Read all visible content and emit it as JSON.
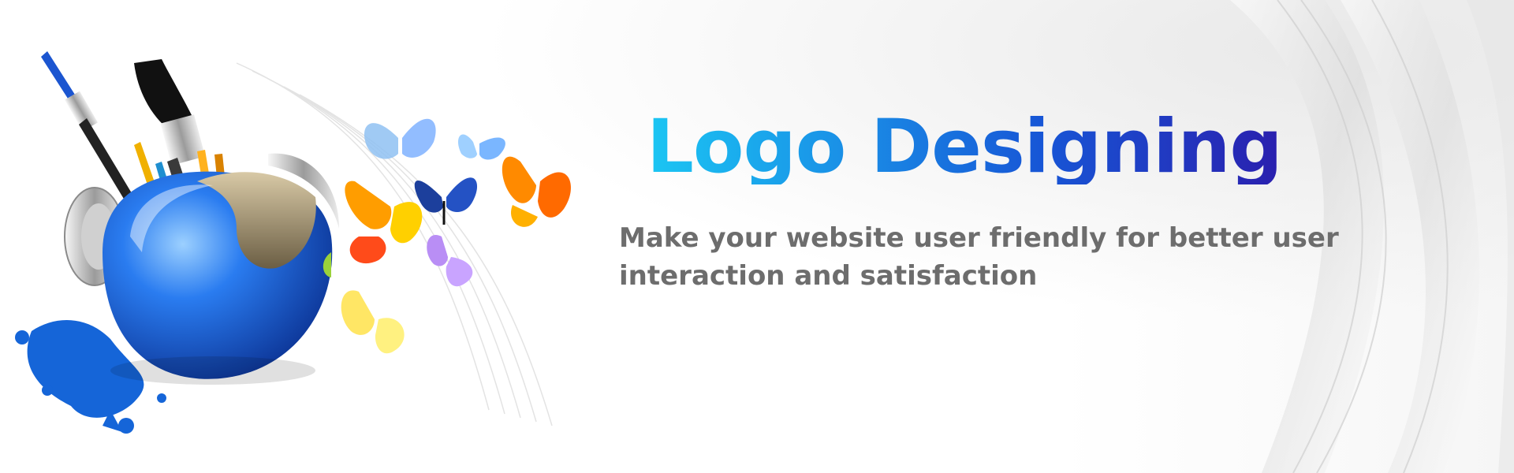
{
  "banner": {
    "headline": "Logo Designing",
    "tagline_line1": "Make your website user friendly for better user",
    "tagline_line2": "interaction and satisfaction"
  },
  "illustration": {
    "icon": "paint-brush-cup-icon",
    "accent_colors": [
      "#1565d8",
      "#ff8a00",
      "#ffd800",
      "#7fb2ff",
      "#b98ef5",
      "#1c3f9c"
    ]
  },
  "headline_gradient": [
    "#1bc6f3",
    "#1a8ee6",
    "#1756d6",
    "#2a1fae"
  ],
  "tagline_color": "#6d6d6d"
}
